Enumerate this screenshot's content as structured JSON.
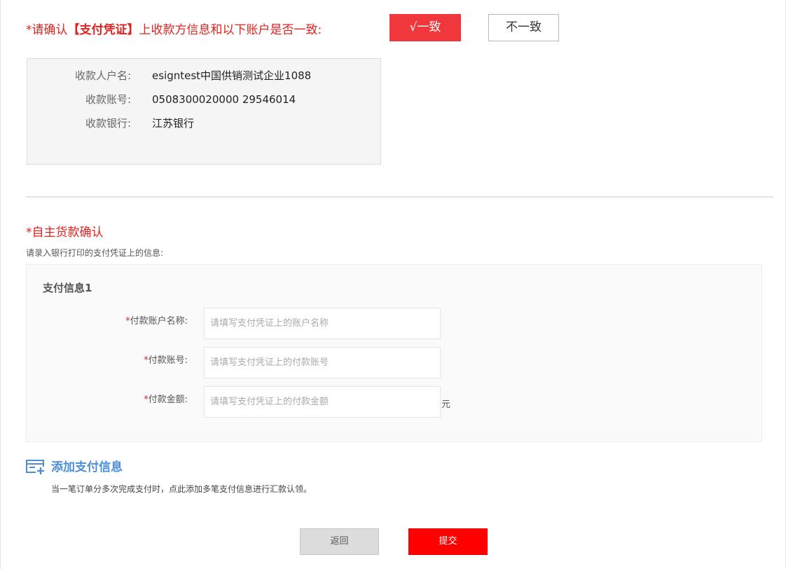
{
  "confirm": {
    "prefix": "*请确认",
    "highlight": "【支付凭证】",
    "suffix": "上收款方信息和以下账户是否一致:",
    "consistent_label": "√一致",
    "inconsistent_label": "不一致"
  },
  "payee": {
    "rows": [
      {
        "label": "收款人户名:",
        "value": "esigntest中国供销测试企业1088"
      },
      {
        "label": "收款账号:",
        "value": "0508300020000 29546014"
      },
      {
        "label": "收款银行:",
        "value": "江苏银行"
      }
    ]
  },
  "self_confirm": {
    "title": "*自主货款确认",
    "instruction": "请录入银行打印的支付凭证上的信息:"
  },
  "payment_info": {
    "title": "支付信息1",
    "fields": [
      {
        "required_mark": "*",
        "label": "付款账户名称:",
        "value": "",
        "placeholder": "请填写支付凭证上的账户名称"
      },
      {
        "required_mark": "*",
        "label": "付款账号:",
        "value": "",
        "placeholder": "请填写支付凭证上的付款账号"
      },
      {
        "required_mark": "*",
        "label": "付款金额:",
        "value": "",
        "placeholder": "请填写支付凭证上的付款金额",
        "unit": "元"
      }
    ]
  },
  "add_payment": {
    "label": "添加支付信息",
    "icon": "add-list-icon",
    "hint": "当一笔订单分多次完成支付时，点此添加多笔支付信息进行汇款认领。"
  },
  "actions": {
    "back_label": "返回",
    "submit_label": "提交"
  },
  "colors": {
    "primary_red": "#f0373b",
    "submit_red": "#ff0000",
    "link_blue": "#4b8fdc"
  }
}
